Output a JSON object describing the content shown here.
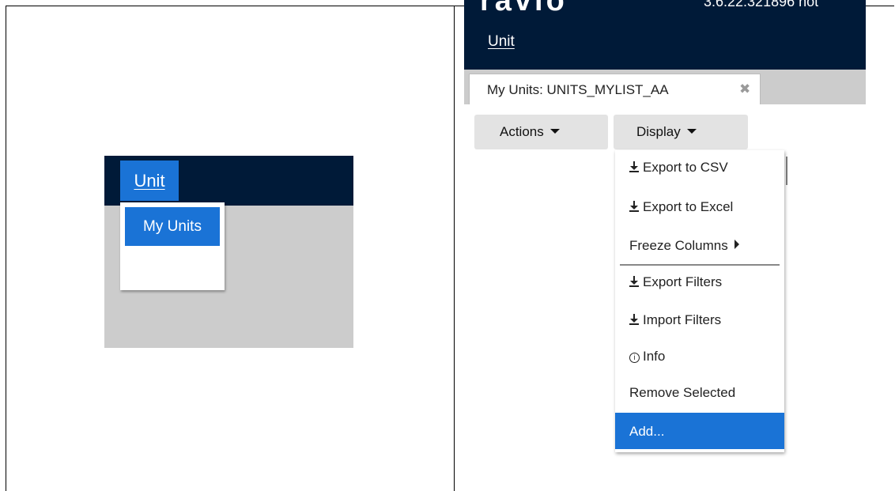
{
  "left_screenshot": {
    "menu_label": "Unit",
    "dropdown_item": "My Units"
  },
  "right_screenshot": {
    "header": {
      "logo_fragment": "ravio",
      "version_text": "3.6.22.321896   not"
    },
    "menubar": {
      "unit_label": "Unit"
    },
    "tab": {
      "label": "My Units: UNITS_MYLIST_AA",
      "close_glyph": "✖"
    },
    "buttons": {
      "actions_label": "Actions",
      "display_label": "Display"
    },
    "display_menu": {
      "items": [
        {
          "label": "Export to CSV",
          "icon": "download-icon"
        },
        {
          "label": "Export to Excel",
          "icon": "download-icon"
        },
        {
          "label": "Freeze Columns",
          "icon": "caret-right-icon"
        },
        {
          "label": "Export Filters",
          "icon": "download-icon"
        },
        {
          "label": "Import Filters",
          "icon": "download-icon"
        },
        {
          "label": "Info",
          "icon": "info-icon"
        },
        {
          "label": "Remove Selected",
          "icon": ""
        },
        {
          "label": "Add...",
          "icon": ""
        }
      ]
    }
  },
  "colors": {
    "navbar": "#001a38",
    "highlight": "#1a73d6",
    "content_gray": "#cccccc",
    "button_gray": "#e3e3e3"
  }
}
